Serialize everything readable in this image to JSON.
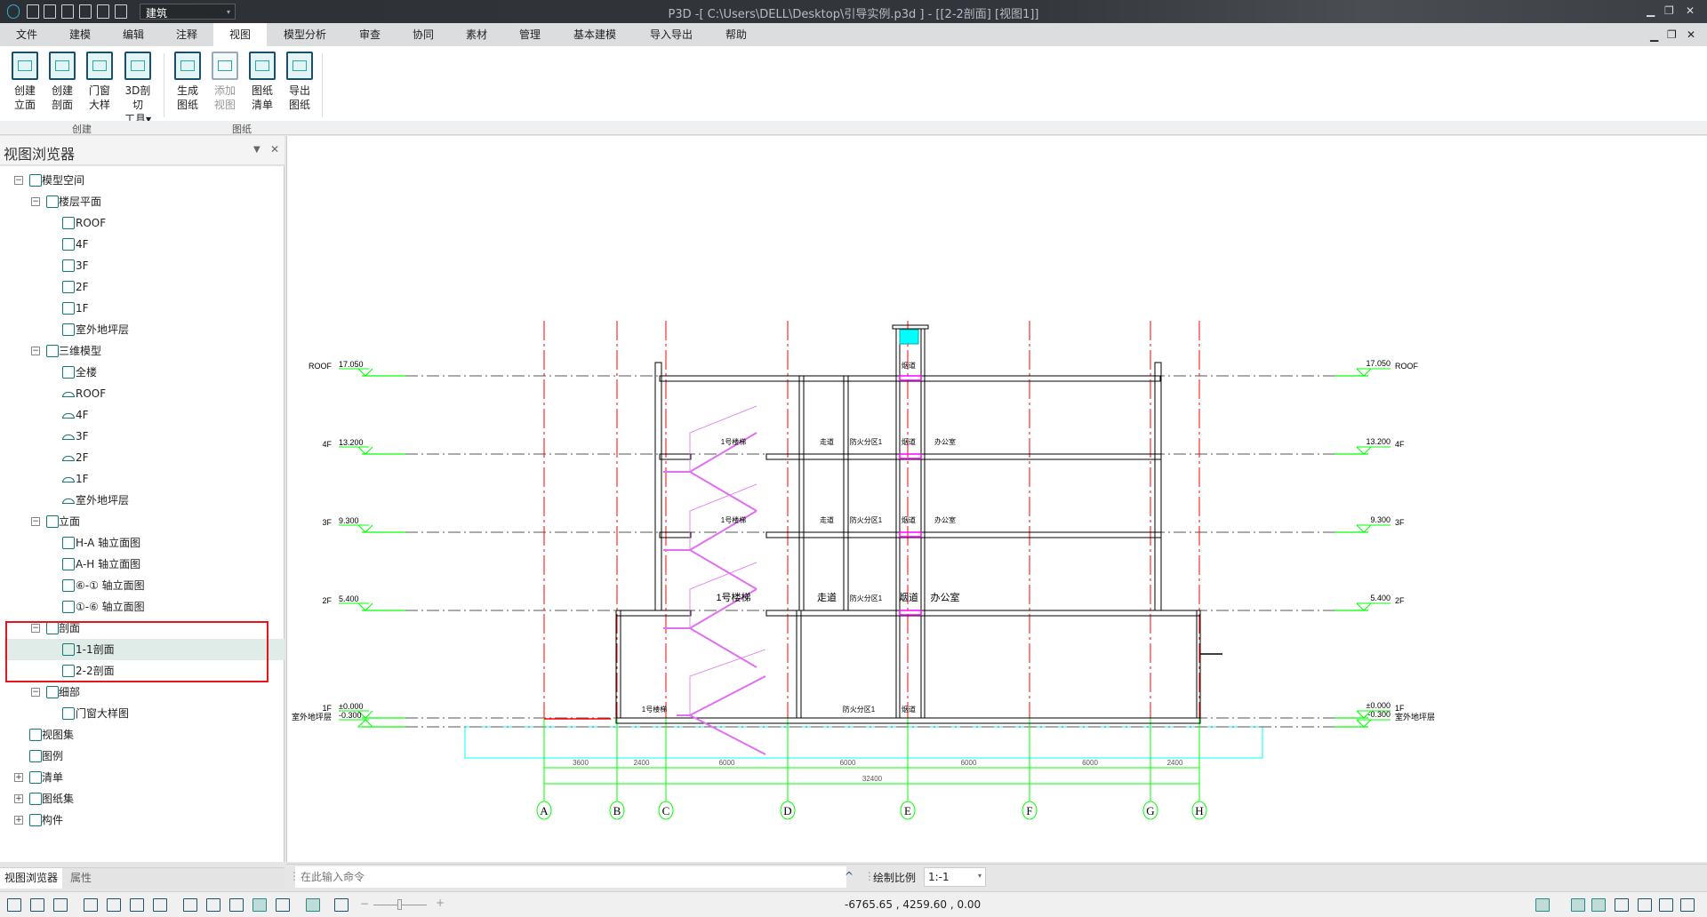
{
  "titlebar": {
    "title": "P3D -[ C:\\Users\\DELL\\Desktop\\引导实例.p3d ] - [[2-2剖面] [视图1]]",
    "discipline": "建筑",
    "icons": [
      "app-logo-icon",
      "new-file-icon",
      "open-folder-icon",
      "save-icon",
      "save-as-icon",
      "undo-icon",
      "redo-icon"
    ]
  },
  "menu": {
    "tabs": [
      "文件",
      "建模",
      "编辑",
      "注释",
      "视图",
      "模型分析",
      "审查",
      "协同",
      "素材",
      "管理",
      "基本建模",
      "导入导出",
      "帮助"
    ],
    "active": "视图"
  },
  "ribbon": {
    "groups": [
      {
        "label": "创建",
        "buttons": [
          {
            "l1": "创建",
            "l2": "立面"
          },
          {
            "l1": "创建",
            "l2": "剖面"
          },
          {
            "l1": "门窗",
            "l2": "大样"
          },
          {
            "l1": "3D剖切",
            "l2": "工具▾"
          }
        ]
      },
      {
        "label": "图纸",
        "buttons": [
          {
            "l1": "生成",
            "l2": "图纸"
          },
          {
            "l1": "添加",
            "l2": "视图",
            "disabled": true
          },
          {
            "l1": "图纸",
            "l2": "清单"
          },
          {
            "l1": "导出",
            "l2": "图纸"
          }
        ]
      }
    ]
  },
  "panel": {
    "title": "视图浏览器",
    "tree": [
      {
        "label": "模型空间",
        "level": 0,
        "exp": "⊟"
      },
      {
        "label": "楼层平面",
        "level": 1,
        "exp": "⊟"
      },
      {
        "label": "ROOF",
        "level": 2
      },
      {
        "label": "4F",
        "level": 2
      },
      {
        "label": "3F",
        "level": 2
      },
      {
        "label": "2F",
        "level": 2
      },
      {
        "label": "1F",
        "level": 2
      },
      {
        "label": "室外地坪层",
        "level": 2
      },
      {
        "label": "三维模型",
        "level": 1,
        "exp": "⊟"
      },
      {
        "label": "全楼",
        "level": 2
      },
      {
        "label": "ROOF",
        "level": 2,
        "flat": true
      },
      {
        "label": "4F",
        "level": 2,
        "flat": true
      },
      {
        "label": "3F",
        "level": 2,
        "flat": true
      },
      {
        "label": "2F",
        "level": 2,
        "flat": true
      },
      {
        "label": "1F",
        "level": 2,
        "flat": true
      },
      {
        "label": "室外地坪层",
        "level": 2,
        "flat": true
      },
      {
        "label": "立面",
        "level": 1,
        "exp": "⊟"
      },
      {
        "label": "H-A 轴立面图",
        "level": 2
      },
      {
        "label": "A-H 轴立面图",
        "level": 2
      },
      {
        "label": "⑥-① 轴立面图",
        "level": 2
      },
      {
        "label": "①-⑥ 轴立面图",
        "level": 2
      },
      {
        "label": "剖面",
        "level": 1,
        "exp": "⊟"
      },
      {
        "label": "1-1剖面",
        "level": 2,
        "selected": true
      },
      {
        "label": "2-2剖面",
        "level": 2
      },
      {
        "label": "细部",
        "level": 1,
        "exp": "⊟"
      },
      {
        "label": "门窗大样图",
        "level": 2
      },
      {
        "label": "视图集",
        "level": 0
      },
      {
        "label": "图例",
        "level": 0
      },
      {
        "label": "清单",
        "level": 0,
        "exp": "⊞"
      },
      {
        "label": "图纸集",
        "level": 0,
        "exp": "⊞"
      },
      {
        "label": "构件",
        "level": 0,
        "exp": "⊞"
      }
    ],
    "tabs": [
      "视图浏览器",
      "属性"
    ]
  },
  "drawing": {
    "axes": [
      "A",
      "B",
      "C",
      "D",
      "E",
      "F",
      "G",
      "H"
    ],
    "spans": [
      "3600",
      "2400",
      "6000",
      "6000",
      "6000",
      "6000",
      "2400"
    ],
    "total": "32400",
    "levels": [
      {
        "name": "ROOF",
        "elev": "17.050"
      },
      {
        "name": "4F",
        "elev": "13.200"
      },
      {
        "name": "3F",
        "elev": "9.300"
      },
      {
        "name": "2F",
        "elev": "5.400"
      },
      {
        "name": "1F",
        "elev": "±0.000"
      },
      {
        "name": "室外地坪层",
        "elev": "-0.300"
      }
    ],
    "rooms": {
      "stair": "1号楼梯",
      "corridor": "走道",
      "fire_zone": "防火分区1",
      "flue": "烟道",
      "office": "办公室"
    },
    "colors": {
      "axis": "#ff0000",
      "level": "#00ff00",
      "stair": "#e070f0",
      "foundation": "#00ffff",
      "opening": "#ff00ff"
    }
  },
  "cmdbar": {
    "placeholder": "在此输入命令",
    "scale_label": "绘制比例",
    "scale_value": "1:-1"
  },
  "statusbar": {
    "coords": "-6765.65 , 4259.60 , 0.00"
  }
}
